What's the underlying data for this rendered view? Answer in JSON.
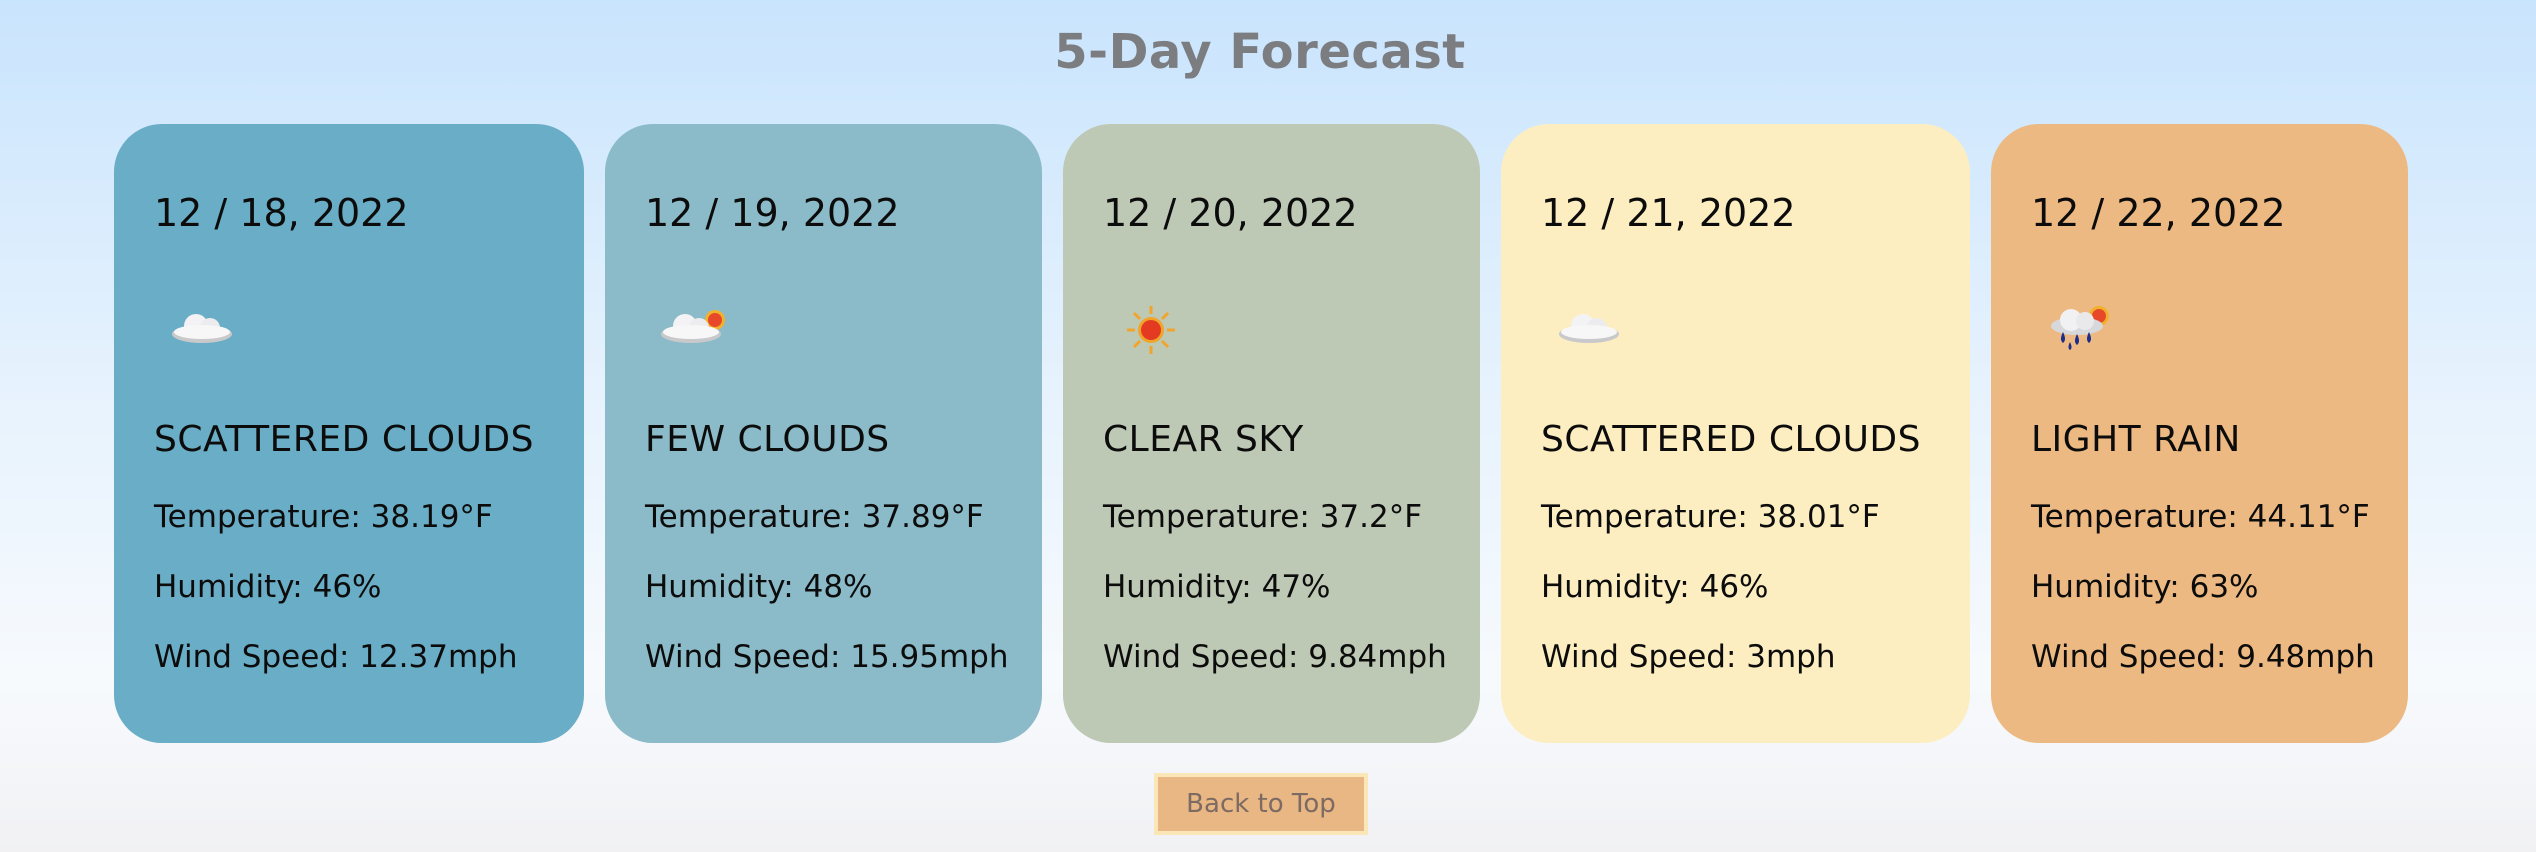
{
  "page": {
    "title": "5-Day Forecast"
  },
  "forecast": [
    {
      "date": "12 / 18, 2022",
      "icon": "scattered-clouds-icon",
      "condition": "SCATTERED CLOUDS",
      "temperature": "Temperature: 38.19°F",
      "humidity": "Humidity: 46%",
      "wind": "Wind Speed: 12.37mph",
      "bg_color": "#6aadc6"
    },
    {
      "date": "12 / 19, 2022",
      "icon": "few-clouds-icon",
      "condition": "FEW CLOUDS",
      "temperature": "Temperature: 37.89°F",
      "humidity": "Humidity: 48%",
      "wind": "Wind Speed: 15.95mph",
      "bg_color": "#8bbac9"
    },
    {
      "date": "12 / 20, 2022",
      "icon": "clear-sky-icon",
      "condition": "CLEAR SKY",
      "temperature": "Temperature: 37.2°F",
      "humidity": "Humidity: 47%",
      "wind": "Wind Speed: 9.84mph",
      "bg_color": "#bdc8b5"
    },
    {
      "date": "12 / 21, 2022",
      "icon": "scattered-clouds-icon",
      "condition": "SCATTERED CLOUDS",
      "temperature": "Temperature: 38.01°F",
      "humidity": "Humidity: 46%",
      "wind": "Wind Speed: 3mph",
      "bg_color": "#fdeec1"
    },
    {
      "date": "12 / 22, 2022",
      "icon": "light-rain-icon",
      "condition": "LIGHT RAIN",
      "temperature": "Temperature: 44.11°F",
      "humidity": "Humidity: 63%",
      "wind": "Wind Speed: 9.48mph",
      "bg_color": "#edb983"
    }
  ],
  "footer": {
    "back_to_top_label": "Back to Top"
  }
}
